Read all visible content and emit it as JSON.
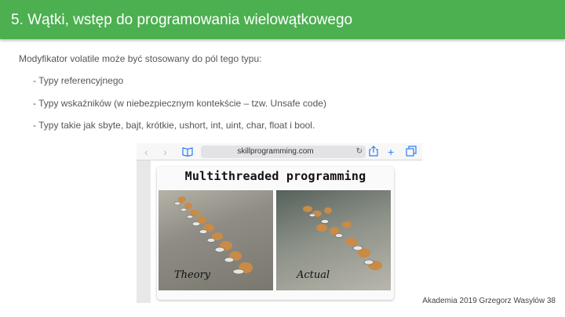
{
  "slide": {
    "title": "5. Wątki, wstęp do programowania wielowątkowego",
    "lead": "Modyfikator volatile może być stosowany do pól tego typu:",
    "bullets": [
      "- Typy referencyjnego",
      "- Typy wskaźników (w niebezpiecznym kontekście – tzw. Unsafe code)",
      "- Typy takie jak sbyte, bajt, krótkie, ushort, int, uint, char, float i bool."
    ],
    "footer": "Akademia 2019 Grzegorz Wasylów 38"
  },
  "browser": {
    "url": "skillprogramming.com",
    "back_icon": "chevron-left-icon",
    "forward_icon": "chevron-right-icon",
    "bookmarks_icon": "book-icon",
    "reload_icon": "reload-icon",
    "share_icon": "share-icon",
    "new_tab_icon": "plus-icon",
    "tabs_icon": "tabs-icon"
  },
  "meme": {
    "title": "Multithreaded programming",
    "left_label": "Theory",
    "right_label": "Actual"
  },
  "colors": {
    "title_bar": "#4caf50",
    "title_text": "#ffffff",
    "body_text": "#555555",
    "browser_accent": "#2d7cf6"
  }
}
